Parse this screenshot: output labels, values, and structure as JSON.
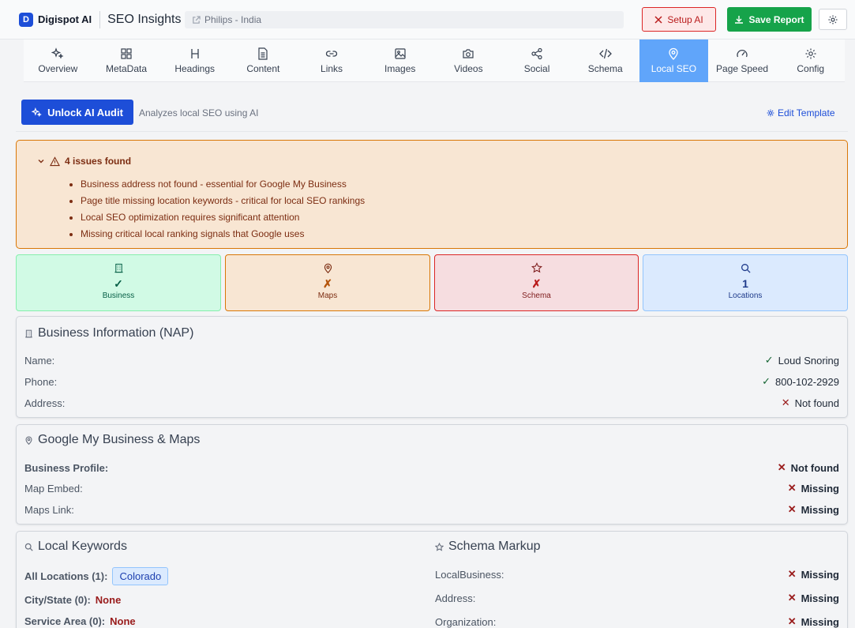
{
  "header": {
    "brand_initial": "D",
    "brand_name": "Digispot AI",
    "app_title": "SEO Insights",
    "url_text": "Philips - India",
    "setup_label": "Setup AI",
    "save_label": "Save Report"
  },
  "tabs": [
    {
      "label": "Overview",
      "icon": "sparkles-icon"
    },
    {
      "label": "MetaData",
      "icon": "grid-icon"
    },
    {
      "label": "Headings",
      "icon": "heading-icon"
    },
    {
      "label": "Content",
      "icon": "document-icon"
    },
    {
      "label": "Links",
      "icon": "link-icon"
    },
    {
      "label": "Images",
      "icon": "image-icon"
    },
    {
      "label": "Videos",
      "icon": "camera-icon"
    },
    {
      "label": "Social",
      "icon": "share-icon"
    },
    {
      "label": "Schema",
      "icon": "code-icon"
    },
    {
      "label": "Local SEO",
      "icon": "map-pin-icon",
      "active": true
    },
    {
      "label": "Page Speed",
      "icon": "gauge-icon"
    },
    {
      "label": "Config",
      "icon": "gear-icon"
    }
  ],
  "toolbar": {
    "unlock_label": "Unlock AI Audit",
    "unlock_desc": "Analyzes local SEO using AI",
    "edit_template": "Edit Template"
  },
  "issues": {
    "title": "4 issues found",
    "items": [
      "Business address not found - essential for Google My Business",
      "Page title missing location keywords - critical for local SEO rankings",
      "Local SEO optimization requires significant attention",
      "Missing critical local ranking signals that Google uses"
    ]
  },
  "cards": [
    {
      "value": "✓",
      "label": "Business",
      "color": "#065f46"
    },
    {
      "value": "✗",
      "label": "Maps",
      "color": "#b45309"
    },
    {
      "value": "✗",
      "label": "Schema",
      "color": "#b91c1c"
    },
    {
      "value": "1",
      "label": "Locations",
      "color": "#1e3a8a"
    }
  ],
  "business_info": {
    "title": "Business Information (NAP)",
    "rows": [
      {
        "label": "Name:",
        "value": "Loud Snoring",
        "ok": true
      },
      {
        "label": "Phone:",
        "value": "800-102-2929",
        "ok": true
      },
      {
        "label": "Address:",
        "value": "Not found",
        "ok": false
      }
    ]
  },
  "gmb": {
    "title": "Google My Business & Maps",
    "rows": [
      {
        "label": "Business Profile:",
        "value": "Not found"
      },
      {
        "label": "Map Embed:",
        "value": "Missing"
      },
      {
        "label": "Maps Link:",
        "value": "Missing"
      }
    ]
  },
  "keywords": {
    "title": "Local Keywords",
    "all_label": "All Locations (1):",
    "all_value": "Colorado",
    "city_label": "City/State (0):",
    "city_value": "None",
    "service_label": "Service Area (0):",
    "service_value": "None"
  },
  "schema": {
    "title": "Schema Markup",
    "rows": [
      {
        "label": "LocalBusiness:",
        "value": "Missing"
      },
      {
        "label": "Address:",
        "value": "Missing"
      },
      {
        "label": "Organization:",
        "value": "Missing"
      }
    ]
  }
}
